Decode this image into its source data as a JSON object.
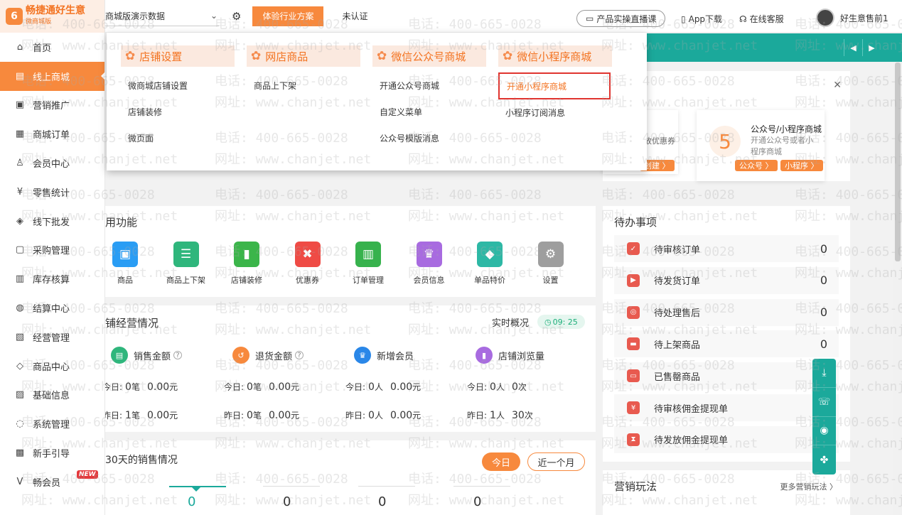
{
  "logo": {
    "mark": "6",
    "text": "畅捷通好生意",
    "sub": "微商城版"
  },
  "sidebar": {
    "items": [
      {
        "label": "首页",
        "icon": "⌂"
      },
      {
        "label": "线上商城",
        "icon": "▤"
      },
      {
        "label": "营销推广",
        "icon": "▣"
      },
      {
        "label": "商城订单",
        "icon": "▦"
      },
      {
        "label": "会员中心",
        "icon": "♙"
      },
      {
        "label": "零售统计",
        "icon": "¥"
      },
      {
        "label": "线下批发",
        "icon": "◈"
      },
      {
        "label": "采购管理",
        "icon": "▢"
      },
      {
        "label": "库存核算",
        "icon": "▥"
      },
      {
        "label": "结算中心",
        "icon": "◍"
      },
      {
        "label": "经营管理",
        "icon": "▧"
      },
      {
        "label": "商品中心",
        "icon": "◇"
      },
      {
        "label": "基础信息",
        "icon": "▨"
      },
      {
        "label": "系统管理",
        "icon": "◌"
      },
      {
        "label": "新手引导",
        "icon": "▩"
      },
      {
        "label": "畅会员",
        "icon": "V"
      }
    ],
    "new_badge": "NEW"
  },
  "topbar": {
    "store_name": "商城版演示数据",
    "solution_btn": "体验行业方案",
    "verify_status": "未认证",
    "live_btn": "产品实操直播课",
    "app_download": "App下载",
    "online_service": "在线客服",
    "username": "好生意售前1"
  },
  "dropdown": {
    "columns": [
      {
        "title": "店铺设置",
        "items": [
          "微商城店铺设置",
          "店铺装修",
          "微页面"
        ]
      },
      {
        "title": "网店商品",
        "items": [
          "商品上下架"
        ]
      },
      {
        "title": "微信公众号商城",
        "items": [
          "开通公众号商城",
          "自定义菜单",
          "公众号模版消息"
        ]
      },
      {
        "title": "微信小程序商城",
        "items": [
          "开通小程序商城",
          "小程序订阅消息"
        ]
      }
    ]
  },
  "notice": {
    "partial_line1": "放优惠券",
    "partial_chip": "创建 〉",
    "step_number": "5",
    "step_title": "公众号/小程序商城",
    "step_desc": "开通公众号或者小程序商城",
    "chip_mp": "公众号 〉",
    "chip_mini": "小程序 〉"
  },
  "functions": {
    "title": "用功能",
    "items": [
      {
        "label": "商品",
        "color": "#2a9df4",
        "icon": "▣"
      },
      {
        "label": "商品上下架",
        "color": "#2fb67c",
        "icon": "☰"
      },
      {
        "label": "店铺装修",
        "color": "#3bb54a",
        "icon": "▮"
      },
      {
        "label": "优惠券",
        "color": "#ef4b45",
        "icon": "✖"
      },
      {
        "label": "订单管理",
        "color": "#37b24d",
        "icon": "▥"
      },
      {
        "label": "会员信息",
        "color": "#a86be0",
        "icon": "♛"
      },
      {
        "label": "单品特价",
        "color": "#2db8a5",
        "icon": "◆"
      },
      {
        "label": "设置",
        "color": "#9e9e9e",
        "icon": "⚙"
      }
    ]
  },
  "business": {
    "title": "铺经营情况",
    "realtime": "实时概况",
    "time": "09: 25",
    "metrics": [
      {
        "label": "销售金额",
        "color": "#2fb67c",
        "icon": "▤",
        "today_count": "0",
        "today_unit": "笔",
        "today_value": "0.00",
        "today_value_unit": "元",
        "yest_count": "1",
        "yest_unit": "笔",
        "yest_value": "0.00",
        "yest_value_unit": "元",
        "help": "?"
      },
      {
        "label": "退货金额",
        "color": "#f7893d",
        "icon": "↺",
        "today_count": "0",
        "today_unit": "笔",
        "today_value": "0.00",
        "today_value_unit": "元",
        "yest_count": "0",
        "yest_unit": "笔",
        "yest_value": "0.00",
        "yest_value_unit": "元",
        "help": "?"
      },
      {
        "label": "新增会员",
        "color": "#2a87e8",
        "icon": "♛",
        "today_count": "0",
        "today_unit": "人",
        "today_value": "0.00",
        "today_value_unit": "元",
        "yest_count": "0",
        "yest_unit": "人",
        "yest_value": "0.00",
        "yest_value_unit": "元",
        "help": ""
      },
      {
        "label": "店铺浏览量",
        "color": "#a86be0",
        "icon": "▮",
        "today_count": "0",
        "today_unit": "人",
        "today_value": "0",
        "today_value_unit": "次",
        "yest_count": "1",
        "yest_unit": "人",
        "yest_value": "30",
        "yest_value_unit": "次",
        "help": ""
      }
    ],
    "today_label": "今日:",
    "yest_label": "昨日:"
  },
  "sales": {
    "title": "30天的销售情况",
    "today_btn": "今日",
    "month_btn": "近一个月",
    "values": [
      "0",
      "0",
      "0",
      "0"
    ]
  },
  "todo": {
    "title": "待办事项",
    "items": [
      {
        "label": "待审核订单",
        "value": "0",
        "icon": "✓"
      },
      {
        "label": "待发货订单",
        "value": "0",
        "icon": "▶"
      },
      {
        "label": "待处理售后",
        "value": "0",
        "icon": "◎"
      },
      {
        "label": "待上架商品",
        "value": "0",
        "icon": "▬"
      },
      {
        "label": "已售罄商品",
        "value": "",
        "icon": "▭"
      },
      {
        "label": "待审核佣金提现单",
        "value": "",
        "icon": "¥"
      },
      {
        "label": "待发放佣金提现单",
        "value": "",
        "icon": "⧗"
      }
    ]
  },
  "marketing": {
    "title": "营销玩法",
    "more": "更多营销玩法 〉"
  },
  "float_tools": [
    "⤓",
    "☏",
    "◉",
    "✤"
  ],
  "watermark": {
    "phone": "电话: 400-665-0028",
    "site": "网址: www.chanjet.net"
  }
}
